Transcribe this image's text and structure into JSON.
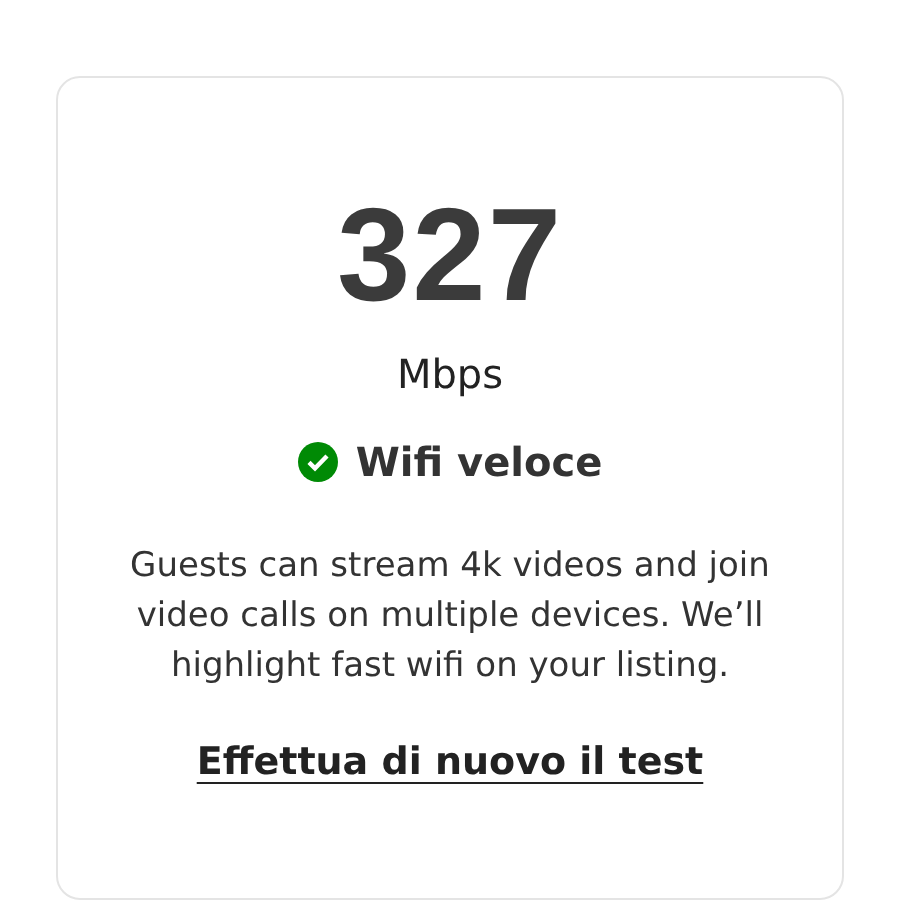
{
  "speed": {
    "value": "327",
    "unit": "Mbps"
  },
  "status": {
    "label": "Wifi veloce",
    "ok": true
  },
  "description": "Guests can stream 4k videos and join video calls on multiple devices. We’ll highlight fast wifi on your listing.",
  "retest_link": "Effettua di nuovo il test"
}
